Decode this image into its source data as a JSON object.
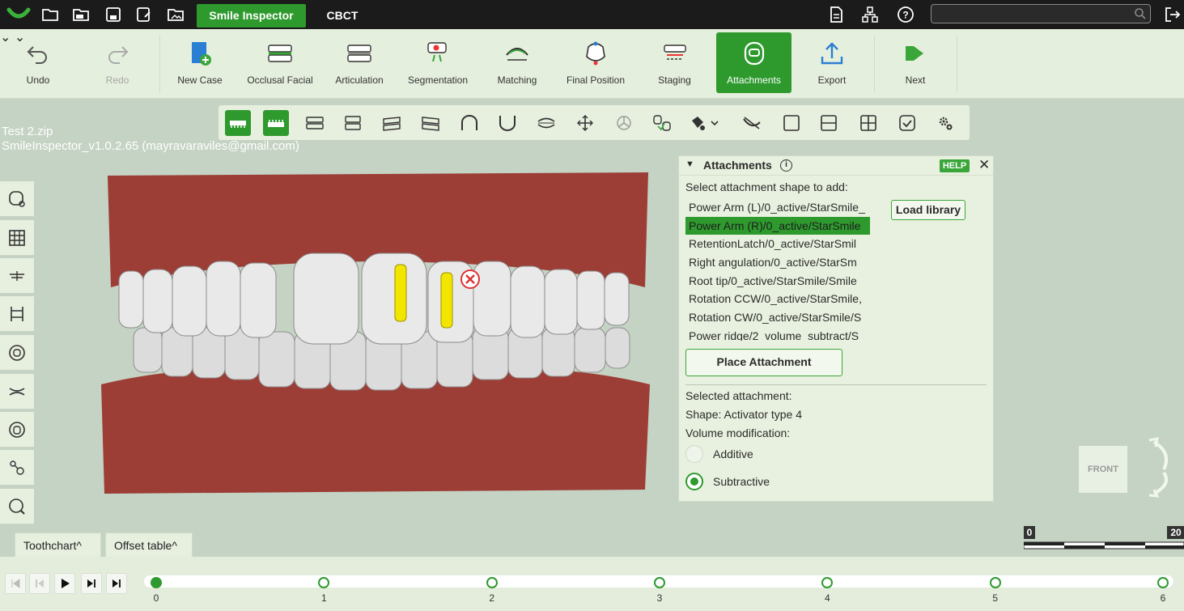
{
  "topbar": {
    "tabs": [
      {
        "label": "Smile Inspector",
        "active": true
      },
      {
        "label": "CBCT",
        "active": false
      }
    ],
    "search": {
      "placeholder": ""
    }
  },
  "toolbar": {
    "undo": "Undo",
    "redo": "Redo",
    "items": [
      {
        "label": "New Case",
        "icon": "new-case-icon"
      },
      {
        "label": "Occlusal Facial",
        "icon": "occlusal-facial-icon"
      },
      {
        "label": "Articulation",
        "icon": "articulation-icon"
      },
      {
        "label": "Segmentation",
        "icon": "segmentation-icon"
      },
      {
        "label": "Matching",
        "icon": "matching-icon"
      },
      {
        "label": "Final Position",
        "icon": "final-position-icon"
      },
      {
        "label": "Staging",
        "icon": "staging-icon"
      },
      {
        "label": "Attachments",
        "icon": "attachments-icon",
        "active": true
      },
      {
        "label": "Export",
        "icon": "export-icon"
      },
      {
        "label": "Next",
        "icon": "next-icon"
      }
    ]
  },
  "file": {
    "name": "Test 2.zip",
    "version": "SmileInspector_v1.0.2.65 (mayravaraviles@gmail.com)"
  },
  "panel": {
    "title": "Attachments",
    "help": "HELP",
    "prompt": "Select attachment shape to add:",
    "load_library": "Load library",
    "shapes": [
      "Power Arm (L)/0_active/StarSmile_",
      "Power Arm (R)/0_active/StarSmile",
      "RetentionLatch/0_active/StarSmil",
      "Right angulation/0_active/StarSm",
      "Root tip/0_active/StarSmile/Smile",
      "Rotation CCW/0_active/StarSmile,",
      "Rotation CW/0_active/StarSmile/S",
      "Power ridge/2_volume_subtract/S"
    ],
    "selected_index": 1,
    "place": "Place Attachment",
    "selected_label": "Selected attachment:",
    "shape_line": "Shape: Activator type 4",
    "volume_label": "Volume modification:",
    "additive": "Additive",
    "subtractive": "Subtractive",
    "volume_selected": "Subtractive"
  },
  "navcube": {
    "face": "FRONT"
  },
  "bottom_tabs": [
    "Toothchart",
    "Offset table"
  ],
  "scale": {
    "min": "0",
    "max": "20"
  },
  "timeline": {
    "stages": [
      "0",
      "1",
      "2",
      "3",
      "4",
      "5",
      "6"
    ],
    "current": 0
  },
  "colors": {
    "accent": "#2e9a2e",
    "gum": "#9c3d36",
    "attachment": "#f2e600"
  }
}
